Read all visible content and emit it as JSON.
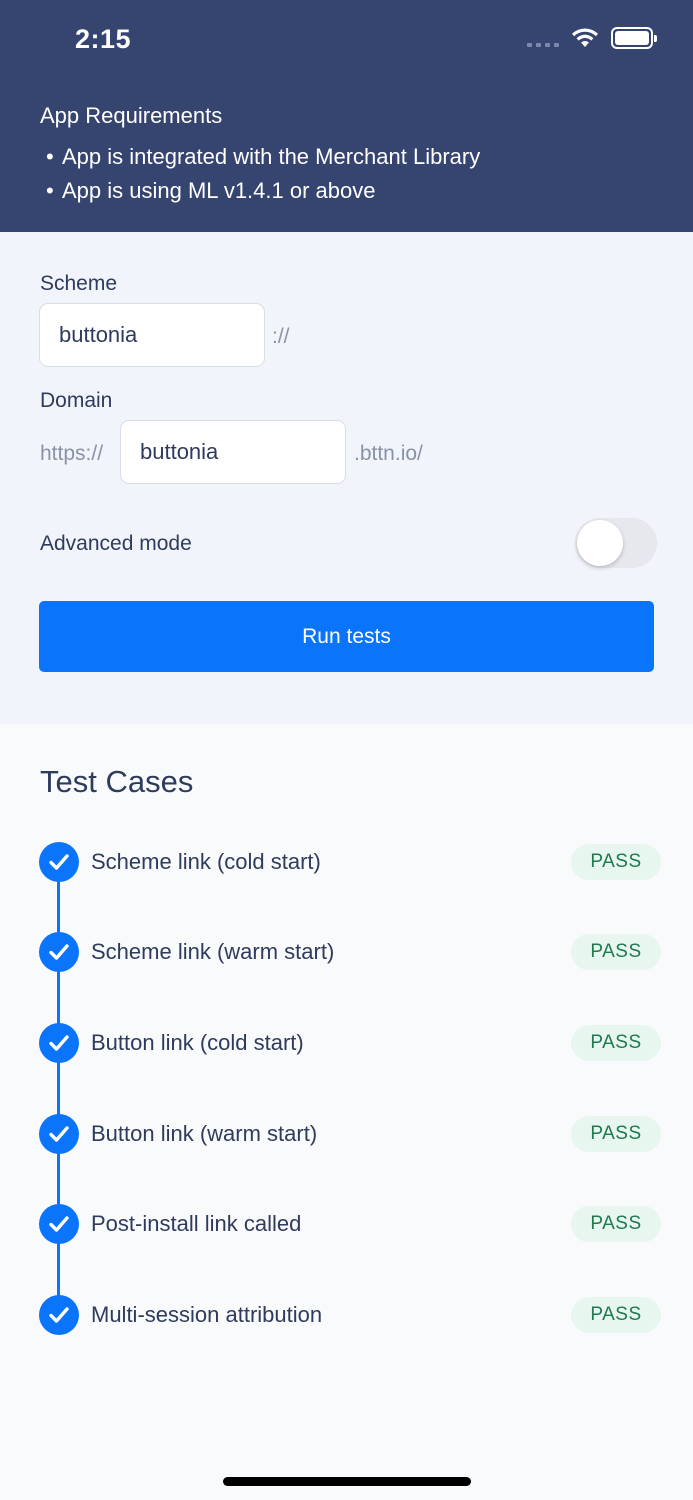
{
  "status_bar": {
    "time": "2:15"
  },
  "requirements": {
    "title": "App Requirements",
    "items": [
      "App is integrated with the Merchant Library",
      "App is using ML v1.4.1 or above"
    ]
  },
  "form": {
    "scheme_label": "Scheme",
    "scheme_value": "buttonia",
    "scheme_suffix": "://",
    "domain_label": "Domain",
    "domain_prefix": "https://",
    "domain_value": "buttonia",
    "domain_suffix": ".bttn.io/",
    "advanced_mode_label": "Advanced mode",
    "advanced_mode_on": false,
    "run_button_label": "Run tests"
  },
  "test_cases": {
    "title": "Test Cases",
    "items": [
      {
        "label": "Scheme link (cold start)",
        "status": "PASS"
      },
      {
        "label": "Scheme link (warm start)",
        "status": "PASS"
      },
      {
        "label": "Button link (cold start)",
        "status": "PASS"
      },
      {
        "label": "Button link (warm start)",
        "status": "PASS"
      },
      {
        "label": "Post-install link called",
        "status": "PASS"
      },
      {
        "label": "Multi-session attribution",
        "status": "PASS"
      }
    ]
  },
  "colors": {
    "header_bg": "#364470",
    "accent": "#0a74fa",
    "pass_text": "#1f7a4e",
    "pass_bg": "#e7f6ef"
  },
  "icons": {
    "signal": "cellular-signal-icon",
    "wifi": "wifi-icon",
    "battery": "battery-icon",
    "check": "checkmark-circle-icon"
  }
}
